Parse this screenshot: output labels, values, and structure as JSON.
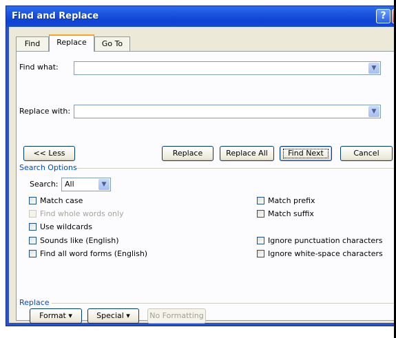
{
  "window": {
    "title": "Find and Replace",
    "help_glyph": "?",
    "close_glyph": "X"
  },
  "tabs": [
    {
      "label": "Find"
    },
    {
      "label": "Replace"
    },
    {
      "label": "Go To"
    }
  ],
  "find": {
    "label": "Find what:",
    "value": ""
  },
  "replace": {
    "label": "Replace with:",
    "value": ""
  },
  "buttons": {
    "less": "<< Less",
    "replace": "Replace",
    "replace_all": "Replace All",
    "find_next": "Find Next",
    "cancel": "Cancel",
    "format": "Format ▾",
    "special": "Special ▾",
    "no_formatting": "No Formatting"
  },
  "search_options": {
    "title": "Search Options",
    "search_label": "Search:",
    "search_value": "All",
    "left": [
      {
        "label": "Match case",
        "checked": false,
        "enabled": true
      },
      {
        "label": "Find whole words only",
        "checked": false,
        "enabled": false
      },
      {
        "label": "Use wildcards",
        "checked": false,
        "enabled": true
      },
      {
        "label": "Sounds like (English)",
        "checked": false,
        "enabled": true
      },
      {
        "label": "Find all word forms (English)",
        "checked": false,
        "enabled": true
      }
    ],
    "right": [
      {
        "label": "Match prefix",
        "checked": false,
        "enabled": true
      },
      {
        "label": "Match suffix",
        "checked": false,
        "enabled": true
      },
      {
        "label": "Ignore punctuation characters",
        "checked": false,
        "enabled": true
      },
      {
        "label": "Ignore white-space characters",
        "checked": false,
        "enabled": true
      }
    ]
  },
  "replace_section": {
    "title": "Replace"
  },
  "colors": {
    "title_bar": "#0f43d2",
    "face": "#ece9d8",
    "group_title": "#0046d5"
  }
}
